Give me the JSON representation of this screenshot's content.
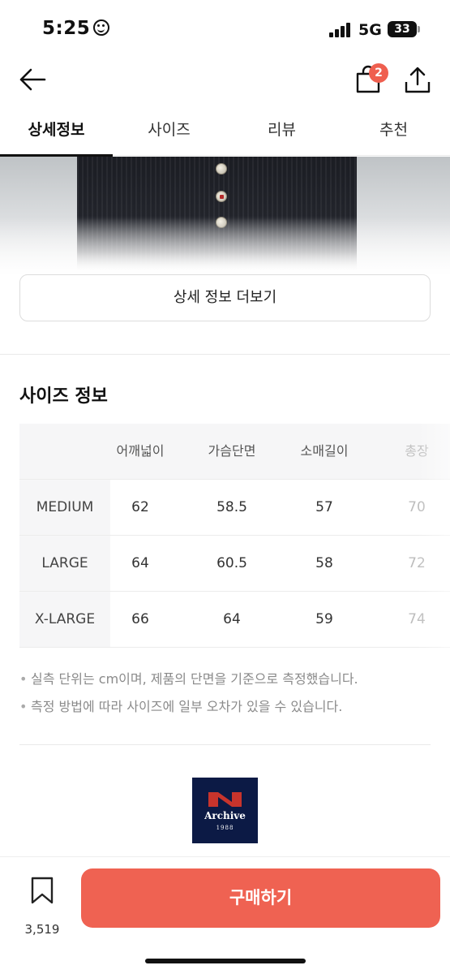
{
  "status_bar": {
    "time": "5:25",
    "network": "5G",
    "battery": "33"
  },
  "header": {
    "cart_count": "2"
  },
  "tabs": [
    {
      "label": "상세정보",
      "active": true
    },
    {
      "label": "사이즈",
      "active": false
    },
    {
      "label": "리뷰",
      "active": false
    },
    {
      "label": "추천",
      "active": false
    }
  ],
  "details": {
    "more_button_label": "상세 정보 더보기"
  },
  "size_info": {
    "title": "사이즈 정보",
    "columns": [
      "어깨넓이",
      "가슴단면",
      "소매길이",
      "총장"
    ],
    "rows": [
      {
        "size": "MEDIUM",
        "values": [
          "62",
          "58.5",
          "57",
          "70"
        ]
      },
      {
        "size": "LARGE",
        "values": [
          "64",
          "60.5",
          "58",
          "72"
        ]
      },
      {
        "size": "X-LARGE",
        "values": [
          "66",
          "64",
          "59",
          "74"
        ]
      }
    ],
    "notes": [
      "실측 단위는 cm이며, 제품의 단면을 기준으로 측정했습니다.",
      "측정 방법에 따라 사이즈에 일부 오차가 있을 수 있습니다."
    ]
  },
  "brand": {
    "logo_text": "Archive",
    "logo_year": "1988",
    "logo_colors": {
      "background": "#0c1a45",
      "mark": "#c8342c"
    }
  },
  "bottom_bar": {
    "like_count": "3,519",
    "buy_label": "구매하기",
    "accent_color": "#ef6252"
  }
}
